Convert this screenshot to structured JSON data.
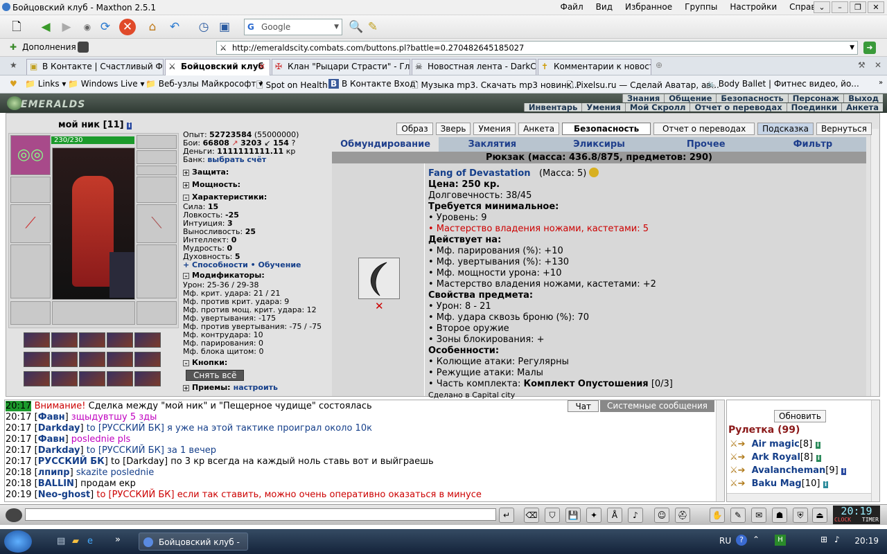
{
  "window": {
    "title": "Бойцовский клуб - Maxthon 2.5.1"
  },
  "menu": [
    "Файл",
    "Вид",
    "Избранное",
    "Группы",
    "Настройки",
    "Справка"
  ],
  "search": {
    "placeholder": "Google"
  },
  "addons": "Дополнения",
  "address": "http://emeraldscity.combats.com/buttons.pl?battle=0.270482645185027",
  "tabs": [
    {
      "label": "В Контакте | Счастливый Фер..."
    },
    {
      "label": "Бойцовский клуб"
    },
    {
      "label": "Клан \"Рыцари Страсти\" - Гла..."
    },
    {
      "label": "Новостная лента - DarkClan"
    },
    {
      "label": "Комментарии к новости"
    }
  ],
  "favorites": [
    "Links",
    "Windows Live",
    "Веб-узлы Майкрософт",
    "Spot on Health",
    "В Контакте  Вход",
    "Музыка mp3. Скачать mp3 новинк...",
    "Pixelsu.ru — Сделай Аватар, ав...",
    "Body Ballet | Фитнес видео, йо..."
  ],
  "game": {
    "logo": "EMERALDS",
    "nav_top": [
      "Знания",
      "Общение",
      "Безопасность",
      "Персонаж",
      "Выход"
    ],
    "nav_bottom": [
      "Инвентарь",
      "Умения",
      "Мой Скролл",
      "Отчет о переводах",
      "Поединки",
      "Анкета"
    ],
    "char_name": "мой ник",
    "char_level": "[11]",
    "hp": "230/230",
    "exp_label": "Опыт:",
    "exp": "52723584",
    "exp_next": "(55000000)",
    "fights_label": "Бои:",
    "fights": "66808",
    "wins": "3203",
    "losses": "154",
    "money_label": "Деньги:",
    "money": "1111111111.11",
    "money_unit": "кр",
    "bank_label": "Банк:",
    "bank_link": "выбрать счёт",
    "sections": {
      "defense": "Защита:",
      "power": "Мощность:",
      "chars": "Характеристики:",
      "mods": "Модификаторы:",
      "buttons": "Кнопки:",
      "tricks": "Приемы:"
    },
    "stats": [
      [
        "Сила:",
        "15"
      ],
      [
        "Ловкость:",
        "-25"
      ],
      [
        "Интуиция:",
        "3"
      ],
      [
        "Выносливость:",
        "25"
      ],
      [
        "Интеллект:",
        "0"
      ],
      [
        "Мудрость:",
        "0"
      ],
      [
        "Духовность:",
        "5"
      ]
    ],
    "abilities": "+ Способности",
    "training": "Обучение",
    "mods": [
      "Урон: 25-36 / 29-38",
      "Мф. крит. удара: 21 / 21",
      "Мф. против крит. удара: 9",
      "Мф. против мощ. крит. удара: 12",
      "Мф. увертывания: -175",
      "Мф. против увертывания: -75 / -75",
      "Мф. контрудара: 10",
      "Мф. парирования: 0",
      "Мф. блока щитом: 0"
    ],
    "undress_button": "Снять всё",
    "configure": "настроить",
    "top_buttons": [
      "Образ",
      "Зверь",
      "Умения",
      "Анкета",
      "Безопасность",
      "Отчет о переводах",
      "Подсказка",
      "Вернуться"
    ],
    "categories": [
      "Обмундирование",
      "Заклятия",
      "Эликсиры",
      "Прочее",
      "Фильтр"
    ],
    "backpack": "Рюкзак (масса: 436.8/875, предметов: 290)",
    "item": {
      "name": "Fang of Devastation",
      "mass": "(Масса: 5)",
      "price": "Цена: 250 кр.",
      "durability": "Долговечность: 38/45",
      "req_title": "Требуется минимальное:",
      "req_level": "• Уровень: 9",
      "req_mastery": "• Мастерство владения ножами, кастетами: 5",
      "acts_title": "Действует на:",
      "acts": [
        "• Мф. парирования (%): +10",
        "• Мф. увертывания (%): +130",
        "• Мф. мощности урона: +10",
        "• Мастерство владения ножами, кастетами: +2"
      ],
      "props_title": "Свойства предмета:",
      "props": [
        "• Урон: 8 - 21",
        "• Мф. удара сквозь броню (%): 70",
        "• Второе оружие",
        "• Зоны блокирования: +"
      ],
      "feat_title": "Особенности:",
      "feats": [
        "• Колющие атаки: Регулярны",
        "• Режущие атаки: Малы"
      ],
      "set_prefix": "• Часть комплекта:",
      "set_name": "Комплект Опустошения",
      "set_count": "[0/3]",
      "made_in": "Сделано в Capital city"
    }
  },
  "chat": {
    "tabs": [
      "Чат",
      "Системные сообщения"
    ],
    "lines": [
      {
        "t": "20:17",
        "pre": "",
        "nick": "",
        "msg": "Сделка между \"мой ник\" и \"Пещерное чудище\" состоялась",
        "warn": "Внимание!",
        "cls": ""
      },
      {
        "t": "20:17",
        "nick": "Фавн",
        "msg": "зщыдувтшу 5 зды",
        "cls": "pink"
      },
      {
        "t": "20:17",
        "nick": "Darkday",
        "msg": "to [РУССКИЙ БК] я уже на этой тактике проиграл около 10к",
        "cls": "blue"
      },
      {
        "t": "20:17",
        "nick": "Фавн",
        "msg": "poslednie pls",
        "cls": "pink"
      },
      {
        "t": "20:17",
        "nick": "Darkday",
        "msg": "to [РУССКИЙ БК] за 1 вечер",
        "cls": "blue"
      },
      {
        "t": "20:17",
        "nick": "РУССКИЙ БК",
        "msg": "to [Darkday] по 3 кр всегда на каждый ноль ставь вот и выйграешь",
        "cls": ""
      },
      {
        "t": "20:18",
        "nick": "лпипр",
        "msg": "skazite poslednie",
        "cls": "blue"
      },
      {
        "t": "20:18",
        "nick": "BALLIN",
        "msg": "продам екр",
        "cls": ""
      },
      {
        "t": "20:19",
        "nick": "Neo-ghost",
        "msg": "to [РУССКИЙ БК] если так ставить, можно очень оперативно оказаться в минусе",
        "cls": "red"
      }
    ]
  },
  "side": {
    "refresh": "Обновить",
    "room": "Рулетка (99)",
    "players": [
      {
        "name": "Air magic",
        "lvl": "[8]"
      },
      {
        "name": "Ark Royal",
        "lvl": "[8]"
      },
      {
        "name": "Avalancheman",
        "lvl": "[9]"
      },
      {
        "name": "Baku Mag",
        "lvl": "[10]"
      }
    ]
  },
  "clock_game": "20:19",
  "clock_labels": [
    "CLOCK",
    "TIMER"
  ],
  "taskbar": {
    "window": "Бойцовский клуб - ...",
    "lang": "RU",
    "time": "20:19"
  },
  "colors": {
    "accent": "#1f3f8c",
    "hp": "#1b9a2b",
    "warn": "#cc0000"
  }
}
